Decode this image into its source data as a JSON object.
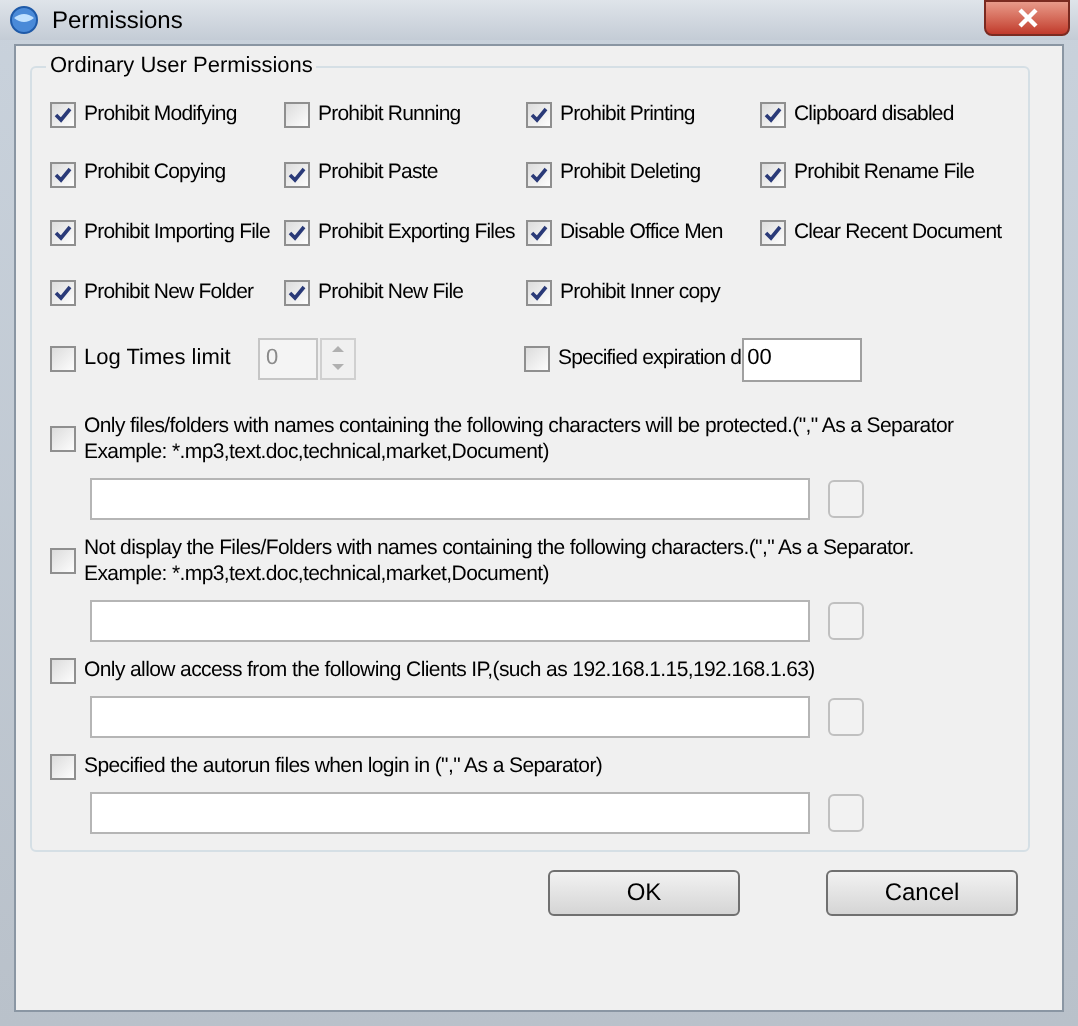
{
  "window": {
    "title": "Permissions"
  },
  "group": {
    "title": "Ordinary User Permissions"
  },
  "options": [
    {
      "label": "Prohibit Modifying",
      "checked": true
    },
    {
      "label": "Prohibit Running",
      "checked": false
    },
    {
      "label": "Prohibit Printing",
      "checked": true
    },
    {
      "label": "Clipboard disabled",
      "checked": true
    },
    {
      "label": "Prohibit Copying",
      "checked": true
    },
    {
      "label": "Prohibit Paste",
      "checked": true
    },
    {
      "label": "Prohibit Deleting",
      "checked": true
    },
    {
      "label": "Prohibit Rename File",
      "checked": true
    },
    {
      "label": "Prohibit Importing File",
      "checked": true
    },
    {
      "label": "Prohibit Exporting Files",
      "checked": true
    },
    {
      "label": "Disable Office Men",
      "checked": true
    },
    {
      "label": "Clear Recent Document",
      "checked": true
    },
    {
      "label": "Prohibit New Folder",
      "checked": true
    },
    {
      "label": "Prohibit New File",
      "checked": true
    },
    {
      "label": "Prohibit Inner copy",
      "checked": true
    }
  ],
  "log_times": {
    "label": "Log Times limit",
    "checked": false,
    "value": "0"
  },
  "expiration": {
    "label": "Specified expiration d",
    "checked": false,
    "value": "00"
  },
  "filters": [
    {
      "label": "Only files/folders with names containing the following characters will be protected.(\",\" As a Separator Example: *.mp3,text.doc,technical,market,Document)",
      "checked": false
    },
    {
      "label": "Not display the Files/Folders with names containing the following characters.(\",\" As a Separator. Example: *.mp3,text.doc,technical,market,Document)",
      "checked": false
    },
    {
      "label": "Only allow access from the following Clients IP,(such as 192.168.1.15,192.168.1.63)",
      "checked": false
    },
    {
      "label": "Specified the autorun files when login in (\",\" As a Separator)",
      "checked": false
    }
  ],
  "buttons": [
    "OK",
    "Cancel"
  ]
}
